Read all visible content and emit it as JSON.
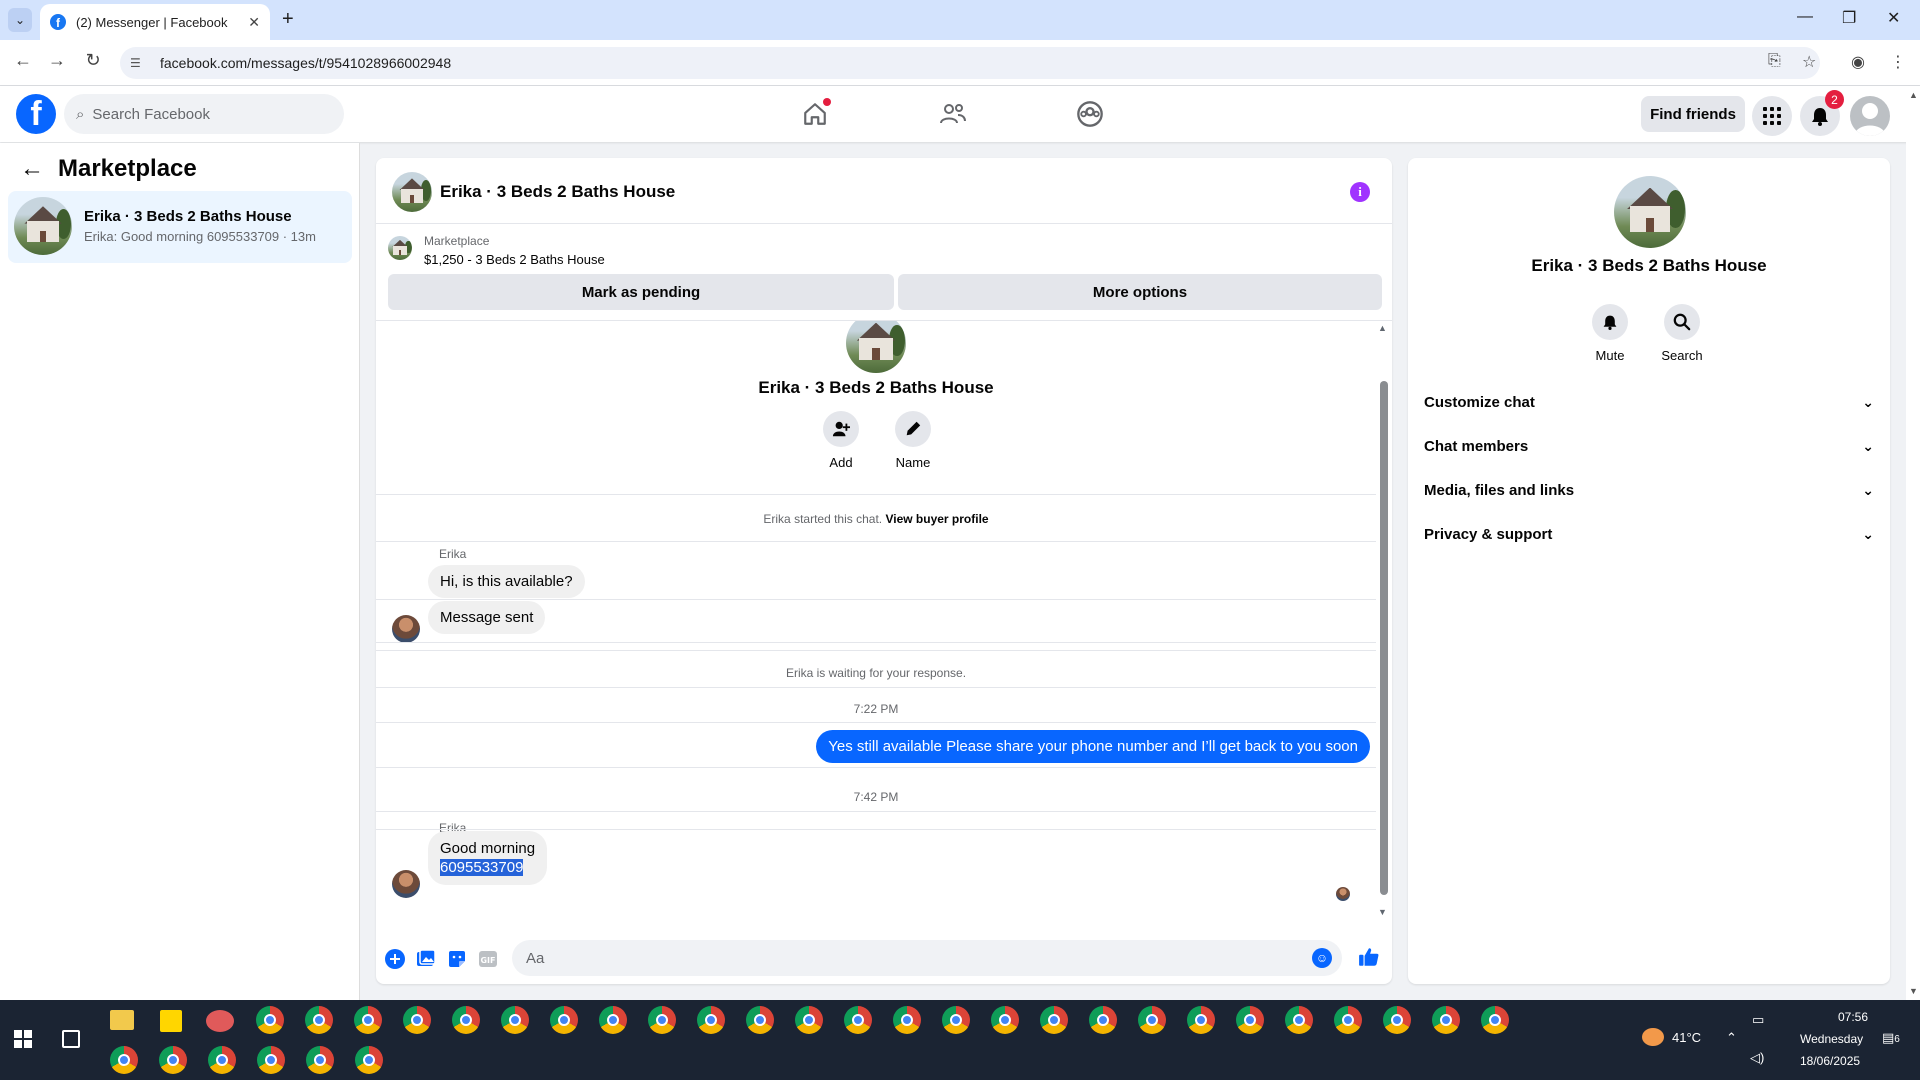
{
  "browser": {
    "tab_title": "(2) Messenger | Facebook",
    "url": "facebook.com/messages/t/9541028966002948"
  },
  "fb": {
    "search_placeholder": "Search Facebook",
    "find_friends": "Find friends",
    "notif_count": "2"
  },
  "left": {
    "title": "Marketplace",
    "conversation": {
      "name": "Erika · 3 Beds 2 Baths House",
      "snippet": "Erika: Good morning 6095533709 · 13m"
    }
  },
  "chat": {
    "title": "Erika · 3 Beds 2 Baths House",
    "marketplace_label": "Marketplace",
    "listing": "$1,250 - 3 Beds 2 Baths House",
    "mark_pending": "Mark as pending",
    "more_options": "More options",
    "thread_name": "Erika · 3 Beds 2 Baths House",
    "action_add": "Add",
    "action_name": "Name",
    "started_text": "Erika started this chat.",
    "view_buyer": "View buyer profile",
    "sender1": "Erika",
    "msg1": "Hi, is this available?",
    "msg2": "Message sent",
    "waiting": "Erika is waiting for your response.",
    "time1": "7:22 PM",
    "msg_out": "Yes still available Please share your phone number and I’ll get back to you soon",
    "time2": "7:42 PM",
    "sender2": "Erika",
    "msg3_line1": "Good morning",
    "msg3_line2": "6095533709",
    "composer_placeholder": "Aa"
  },
  "right": {
    "name": "Erika · 3 Beds 2 Baths House",
    "mute": "Mute",
    "search": "Search",
    "rows": [
      "Customize chat",
      "Chat members",
      "Media, files and links",
      "Privacy & support"
    ]
  },
  "taskbar": {
    "temp": "41°C",
    "time": "07:56",
    "day": "Wednesday",
    "date": "18/06/2025",
    "notif": "6"
  },
  "colors": {
    "accent": "#0866ff",
    "info": "#a033ff",
    "badge": "#e41e3f"
  }
}
